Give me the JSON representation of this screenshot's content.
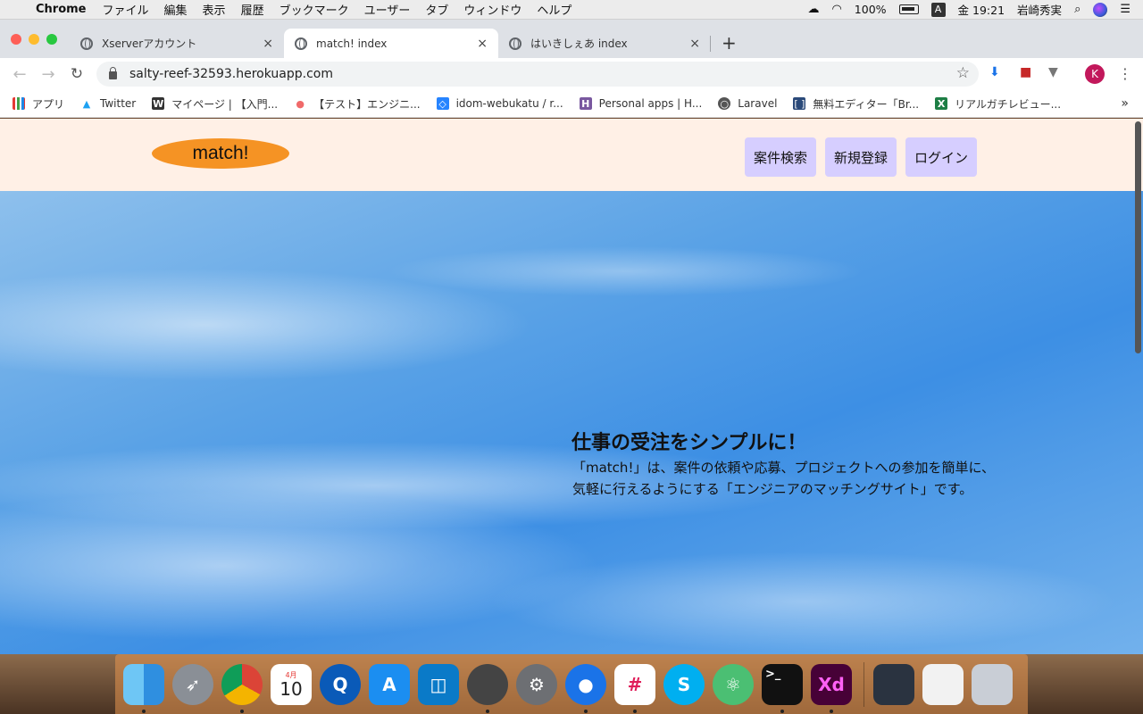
{
  "menubar": {
    "app_name": "Chrome",
    "menus": [
      "ファイル",
      "編集",
      "表示",
      "履歴",
      "ブックマーク",
      "ユーザー",
      "タブ",
      "ウィンドウ",
      "ヘルプ"
    ],
    "battery": "100%",
    "input_mode": "A",
    "clock": "金 19:21",
    "user": "岩崎秀実"
  },
  "tabs": [
    {
      "title": "Xserverアカウント",
      "close": "×"
    },
    {
      "title": "match! index",
      "close": "×"
    },
    {
      "title": "はいきしぇあ index",
      "close": "×"
    }
  ],
  "new_tab": "+",
  "address_bar": {
    "url": "salty-reef-32593.herokuapp.com"
  },
  "profile_initial": "K",
  "bookmarks": [
    {
      "label": "アプリ",
      "icon": "apps-grid-icon"
    },
    {
      "label": "Twitter",
      "icon": "twitter-icon"
    },
    {
      "label": "マイページ | 【入門...",
      "icon": "w-icon"
    },
    {
      "label": "【テスト】エンジニ...",
      "icon": "asana-icon"
    },
    {
      "label": "idom-webukatu / r...",
      "icon": "bitbucket-icon"
    },
    {
      "label": "Personal apps | H...",
      "icon": "heroku-icon"
    },
    {
      "label": "Laravel",
      "icon": "globe-icon"
    },
    {
      "label": "無料エディター「Br...",
      "icon": "bracket-icon"
    },
    {
      "label": "リアルガチレビュー...",
      "icon": "excel-icon"
    }
  ],
  "site": {
    "logo": "match!",
    "nav": [
      "案件検索",
      "新規登録",
      "ログイン"
    ],
    "hero_title": "仕事の受注をシンプルに！",
    "hero_line1": "「match!」は、案件の依頼や応募、プロジェクトへの参加を簡単に、",
    "hero_line2": "気軽に行えるようにする「エンジニアのマッチングサイト」です。"
  },
  "dock": {
    "calendar_month": "4月",
    "calendar_day": "10"
  },
  "colors": {
    "header_bg": "#fff0e6",
    "logo_bg": "#f59324",
    "nav_bg": "#d6ceff",
    "profile": "#c2185b"
  }
}
